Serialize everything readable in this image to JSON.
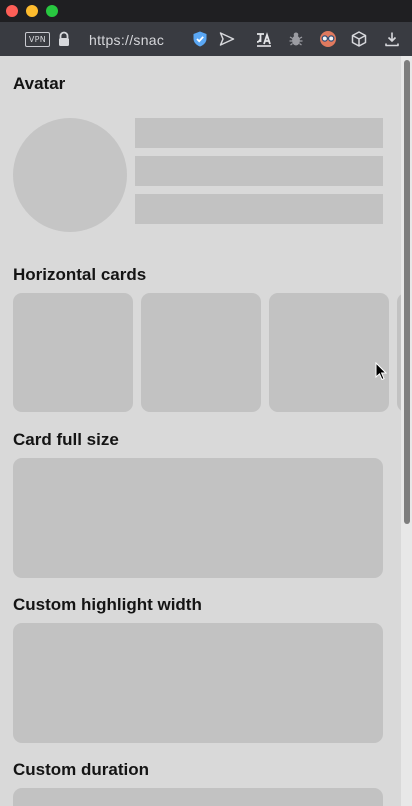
{
  "browser": {
    "vpn_label": "VPN",
    "url": "https://snac"
  },
  "sections": [
    {
      "title": "Avatar"
    },
    {
      "title": "Horizontal cards"
    },
    {
      "title": "Card full size"
    },
    {
      "title": "Custom highlight width"
    },
    {
      "title": "Custom duration"
    }
  ],
  "colors": {
    "skeleton": "#c2c2c2",
    "page_background": "#d9d9d9",
    "toolbar": "#393b41"
  },
  "icons": [
    "lock-icon",
    "shield-icon",
    "send-icon",
    "translate-icon",
    "bug-icon",
    "mask-icon",
    "cube-icon",
    "download-icon"
  ]
}
